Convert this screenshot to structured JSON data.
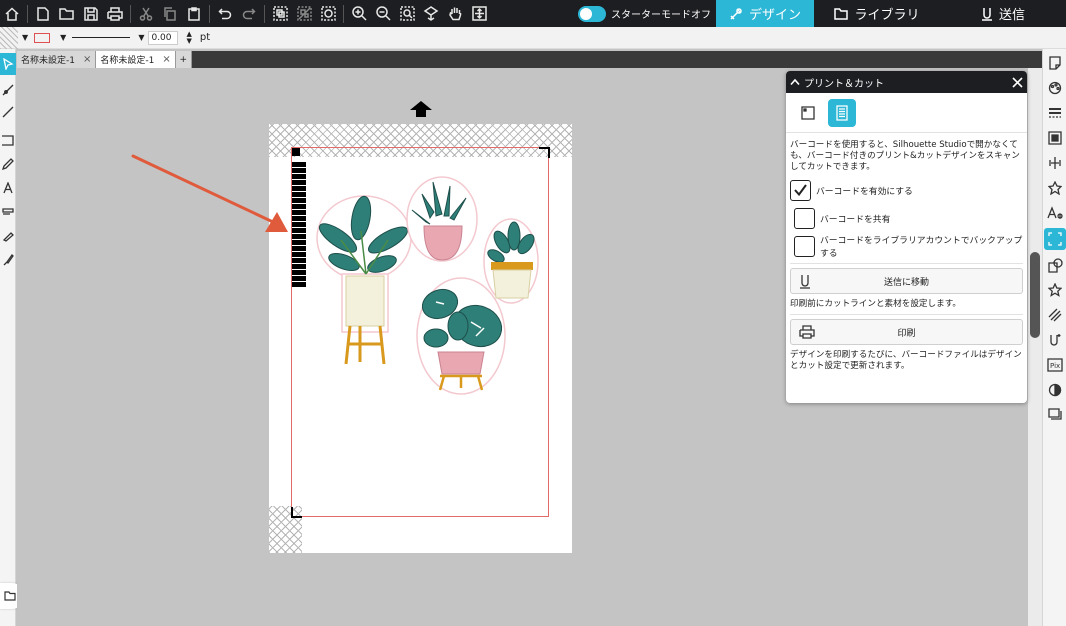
{
  "topbar": {
    "starter_mode_label": "スターターモードオフ",
    "nav": {
      "design": "デザイン",
      "library": "ライブラリ",
      "send": "送信"
    }
  },
  "propbar": {
    "line_width_value": "0.00",
    "unit": "pt"
  },
  "doc_tabs": [
    {
      "label": "名称未設定-1",
      "close": "×"
    },
    {
      "label": "名称未設定-1",
      "close": "×"
    }
  ],
  "doc_tab_add": "+",
  "panel": {
    "title": "プリント＆カット",
    "description": "バーコードを使用すると、Silhouette Studioで開かなくても、バーコード付きのプリント&カットデザインをスキャンしてカットできます。",
    "options": [
      {
        "label": "バーコードを有効にする",
        "checked": true
      },
      {
        "label": "バーコードを共有",
        "checked": false
      },
      {
        "label": "バーコードをライブラリアカウントでバックアップする",
        "checked": false
      }
    ],
    "send_button": "送信に移動",
    "send_note": "印刷前にカットラインと素材を設定します。",
    "print_button": "印刷",
    "print_note": "デザインを印刷するたびに、バーコードファイルはデザインとカット設定で更新されます。"
  },
  "colors": {
    "accent": "#2db7d6",
    "topbar_bg": "#1d1e21",
    "cut_line": "#e56b6b",
    "annotation_arrow": "#e05a3c"
  },
  "icons": {
    "top_toolbar": [
      "home-icon",
      "new-icon",
      "open-icon",
      "save-icon",
      "print-icon",
      "cut-icon",
      "copy-icon",
      "paste-icon",
      "undo-icon",
      "redo-icon",
      "group-icon",
      "ungroup-icon",
      "compound-icon",
      "zoom-in-icon",
      "zoom-out-icon",
      "zoom-select-icon",
      "pan-drag-icon",
      "hand-icon",
      "fit-icon"
    ],
    "right_toolbar": [
      "page-setup-icon",
      "registration-icon",
      "line-style-icon",
      "fill-icon",
      "align-icon",
      "replicate-icon",
      "text-style-icon",
      "print-cut-icon",
      "modify-icon",
      "offset-icon",
      "trace-icon",
      "sketch-icon",
      "pixscan-icon",
      "transparency-icon",
      "layers-icon"
    ]
  }
}
